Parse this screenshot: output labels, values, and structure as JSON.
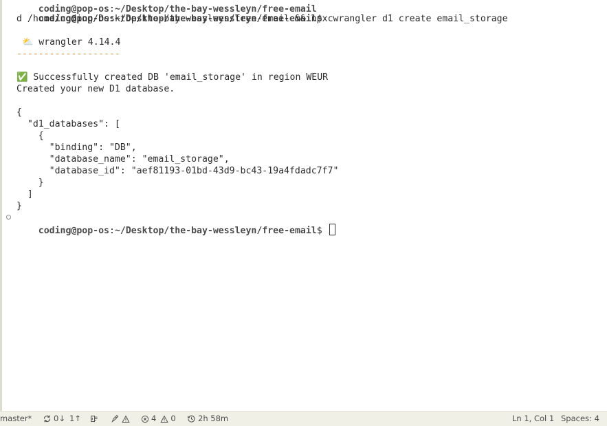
{
  "terminal": {
    "prompt_user": "coding@pop-os",
    "prompt_sep": ":",
    "prompt_path": "~/Desktop/the-bay-wessleyn/free-email",
    "prompt_symbol": "$ ",
    "line1_cmd": "c",
    "line2": "d /home/coding/Desktop/the-bay-wessleyn/free-email && npx wrangler d1 create email_storage",
    "wrangler_line": " ⛅️ wrangler 4.14.4",
    "dashes": "-------------------",
    "success_line": "✅ Successfully created DB 'email_storage' in region WEUR",
    "created_line": "Created your new D1 database.",
    "json_lines": [
      "{",
      "  \"d1_databases\": [",
      "    {",
      "      \"binding\": \"DB\",",
      "      \"database_name\": \"email_storage\",",
      "      \"database_id\": \"aef81193-01bd-43d9-bc43-19a4fdadc7f7\"",
      "    }",
      "  ]",
      "}"
    ]
  },
  "statusbar": {
    "branch": "master*",
    "sync_down": "0↓",
    "sync_up": "1↑",
    "errors": "4",
    "warnings": "0",
    "time": "2h 58m",
    "cursor_pos": "Ln 1, Col 1",
    "spaces": "Spaces: 4"
  },
  "icons": {
    "sync": "sync-icon",
    "extension": "tools-icon",
    "rocket": "rocket-icon",
    "error": "error-circle-icon",
    "warning": "warning-triangle-icon",
    "history": "clock-icon"
  },
  "colors": {
    "terminal_bg": "#ffffff",
    "statusbar_bg": "#f0f0e6",
    "dashes": "#d18a3a",
    "text": "#2b2b2b"
  }
}
